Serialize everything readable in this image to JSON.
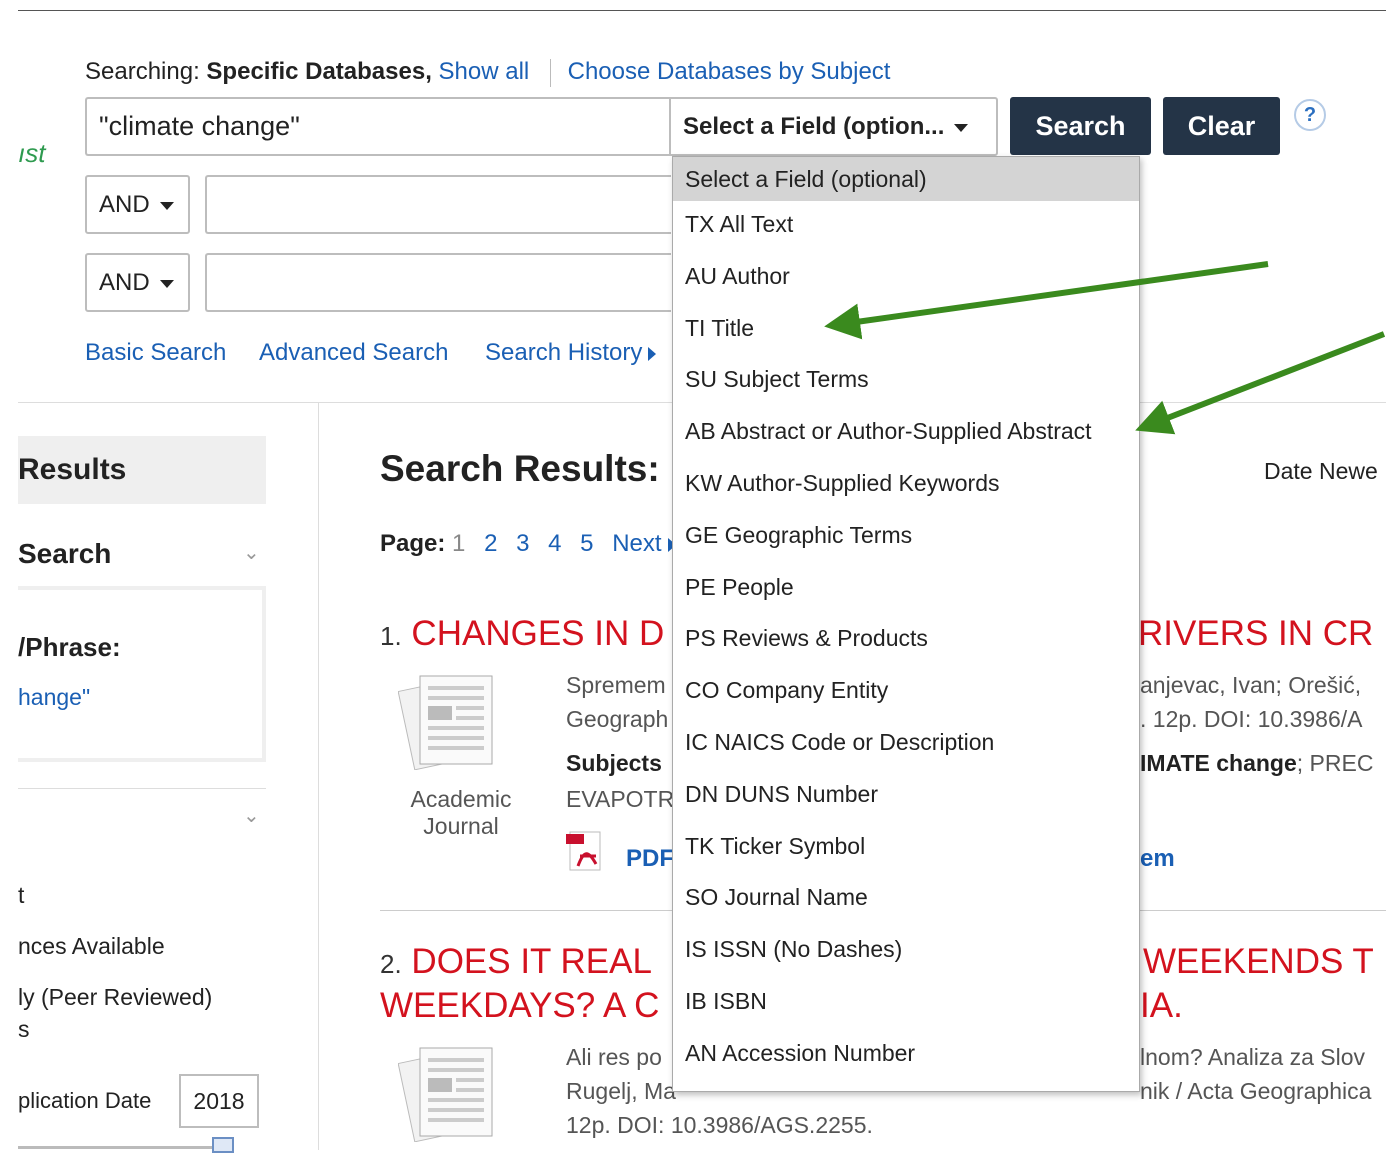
{
  "search_header": {
    "searching_label": "Searching:",
    "scope": "Specific Databases,",
    "show_all": "Show all",
    "choose_databases": "Choose Databases by Subject"
  },
  "logo_fragment": "ıst",
  "search_box": {
    "query_value": "\"climate change\"",
    "field_select_value": "Select a Field (option...",
    "search_label": "Search",
    "clear_label": "Clear",
    "help_label": "?"
  },
  "rows": [
    {
      "bool_value": "AND",
      "input_value": ""
    },
    {
      "bool_value": "AND",
      "input_value": ""
    }
  ],
  "nav_links": {
    "basic": "Basic Search",
    "advanced": "Advanced Search",
    "history": "Search History"
  },
  "field_dropdown": {
    "options": [
      "Select a Field (optional)",
      "TX All Text",
      "AU Author",
      "TI Title",
      "SU Subject Terms",
      "AB Abstract or Author-Supplied Abstract",
      "KW Author-Supplied Keywords",
      "GE Geographic Terms",
      "PE People",
      "PS Reviews & Products",
      "CO Company Entity",
      "IC NAICS Code or Description",
      "DN DUNS Number",
      "TK Ticker Symbol",
      "SO Journal Name",
      "IS ISSN (No Dashes)",
      "IB ISBN",
      "AN Accession Number"
    ]
  },
  "sidebar": {
    "refine_title": "Results",
    "current_search": "Search",
    "phrase_label": "/Phrase:",
    "phrase_value": "hange\"",
    "limit_items": [
      "t",
      "nces Available",
      "ly (Peer Reviewed)",
      "s"
    ],
    "pub_date_label": "plication Date",
    "pub_date_value": "2018"
  },
  "results": {
    "title": "Search Results:",
    "sort_label": "Date Newe",
    "page_label": "Page:",
    "current_page": "1",
    "pages": [
      "2",
      "3",
      "4",
      "5"
    ],
    "next_label": "Next",
    "items": [
      {
        "number": "1.",
        "title_left": "CHANGES IN D",
        "title_right": "RIVERS IN CR",
        "line1_left": "Spremem",
        "line1_right": "anjevac, Ivan; Orešić,",
        "line2_left": "Geograph",
        "line2_right": ". 12p. DOI: 10.3986/A",
        "subjects_label": "Subjects",
        "subjects_right_bold": "IMATE change",
        "subjects_right_rest": "; PREC",
        "line4_left": "EVAPOTR",
        "pub_type": "Academic Journal",
        "pdf_label": "PDF",
        "link_right": "em"
      },
      {
        "number": "2.",
        "title_left": "DOES IT REAL",
        "title_right": "WEEKENDS T",
        "title2_left": "WEEKDAYS? A C",
        "title2_right": "IA.",
        "line1_left": "Ali res po",
        "line1_right": "lnom? Analiza za Slov",
        "line2_left": "Rugelj, Ma",
        "line2_right": "nik / Acta Geographica",
        "line3": "12p. DOI: 10.3986/AGS.2255."
      }
    ]
  },
  "colors": {
    "dark_button": "#243447",
    "link": "#1a5fb4",
    "result_title": "#d3121e",
    "arrow": "#3a8a1e"
  }
}
